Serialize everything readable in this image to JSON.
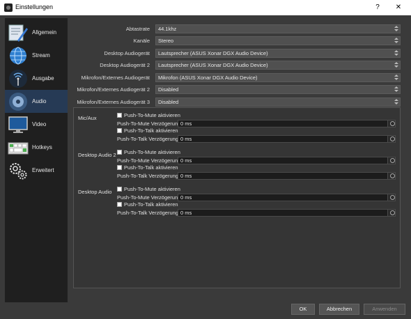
{
  "window": {
    "title": "Einstellungen",
    "help_glyph": "?",
    "close_glyph": "✕"
  },
  "sidebar": {
    "items": [
      {
        "label": "Allgemein",
        "icon": "general-settings-icon"
      },
      {
        "label": "Stream",
        "icon": "stream-globe-icon"
      },
      {
        "label": "Ausgabe",
        "icon": "output-broadcast-icon"
      },
      {
        "label": "Audio",
        "icon": "audio-speaker-icon",
        "active": true
      },
      {
        "label": "Video",
        "icon": "video-monitor-icon"
      },
      {
        "label": "Hotkeys",
        "icon": "hotkeys-keyboard-icon"
      },
      {
        "label": "Erweitert",
        "icon": "advanced-gears-icon"
      }
    ]
  },
  "audio": {
    "settings": [
      {
        "label": "Abtastrate",
        "value": "44.1khz"
      },
      {
        "label": "Kanäle",
        "value": "Stereo"
      },
      {
        "label": "Desktop Audiogerät",
        "value": "Lautsprecher (ASUS Xonar DGX Audio Device)"
      },
      {
        "label": "Desktop Audiogerät 2",
        "value": "Lautsprecher (ASUS Xonar DGX Audio Device)"
      },
      {
        "label": "Mikrofon/Externes Audiogerät",
        "value": "Mikrofon (ASUS Xonar DGX Audio Device)"
      },
      {
        "label": "Mikrofon/Externes Audiogerät 2",
        "value": "Disabled"
      },
      {
        "label": "Mikrofon/Externes Audiogerät 3",
        "value": "Disabled"
      }
    ],
    "devices": [
      {
        "name": "Mic/Aux",
        "ptm_label": "Push-To-Mute aktivieren",
        "ptm_delay_label": "Push-To-Mute Verzögerung",
        "ptm_delay": "0 ms",
        "ptt_label": "Push-To-Talk aktivieren",
        "ptt_delay_label": "Push-To-Talk Verzögerung",
        "ptt_delay": "0 ms"
      },
      {
        "name": "Desktop Audio 2",
        "ptm_label": "Push-To-Mute aktivieren",
        "ptm_delay_label": "Push-To-Mute Verzögerung",
        "ptm_delay": "0 ms",
        "ptt_label": "Push-To-Talk aktivieren",
        "ptt_delay_label": "Push-To-Talk Verzögerung",
        "ptt_delay": "0 ms"
      },
      {
        "name": "Desktop Audio",
        "ptm_label": "Push-To-Mute aktivieren",
        "ptm_delay_label": "Push-To-Mute Verzögerung",
        "ptm_delay": "0 ms",
        "ptt_label": "Push-To-Talk aktivieren",
        "ptt_delay_label": "Push-To-Talk Verzögerung",
        "ptt_delay": "0 ms"
      }
    ]
  },
  "buttons": {
    "ok": "OK",
    "cancel": "Abbrechen",
    "apply": "Anwenden"
  },
  "colors": {
    "accent_active": "#263a55",
    "panel": "#3a3a3a",
    "sidebar": "#1f1f1f"
  }
}
